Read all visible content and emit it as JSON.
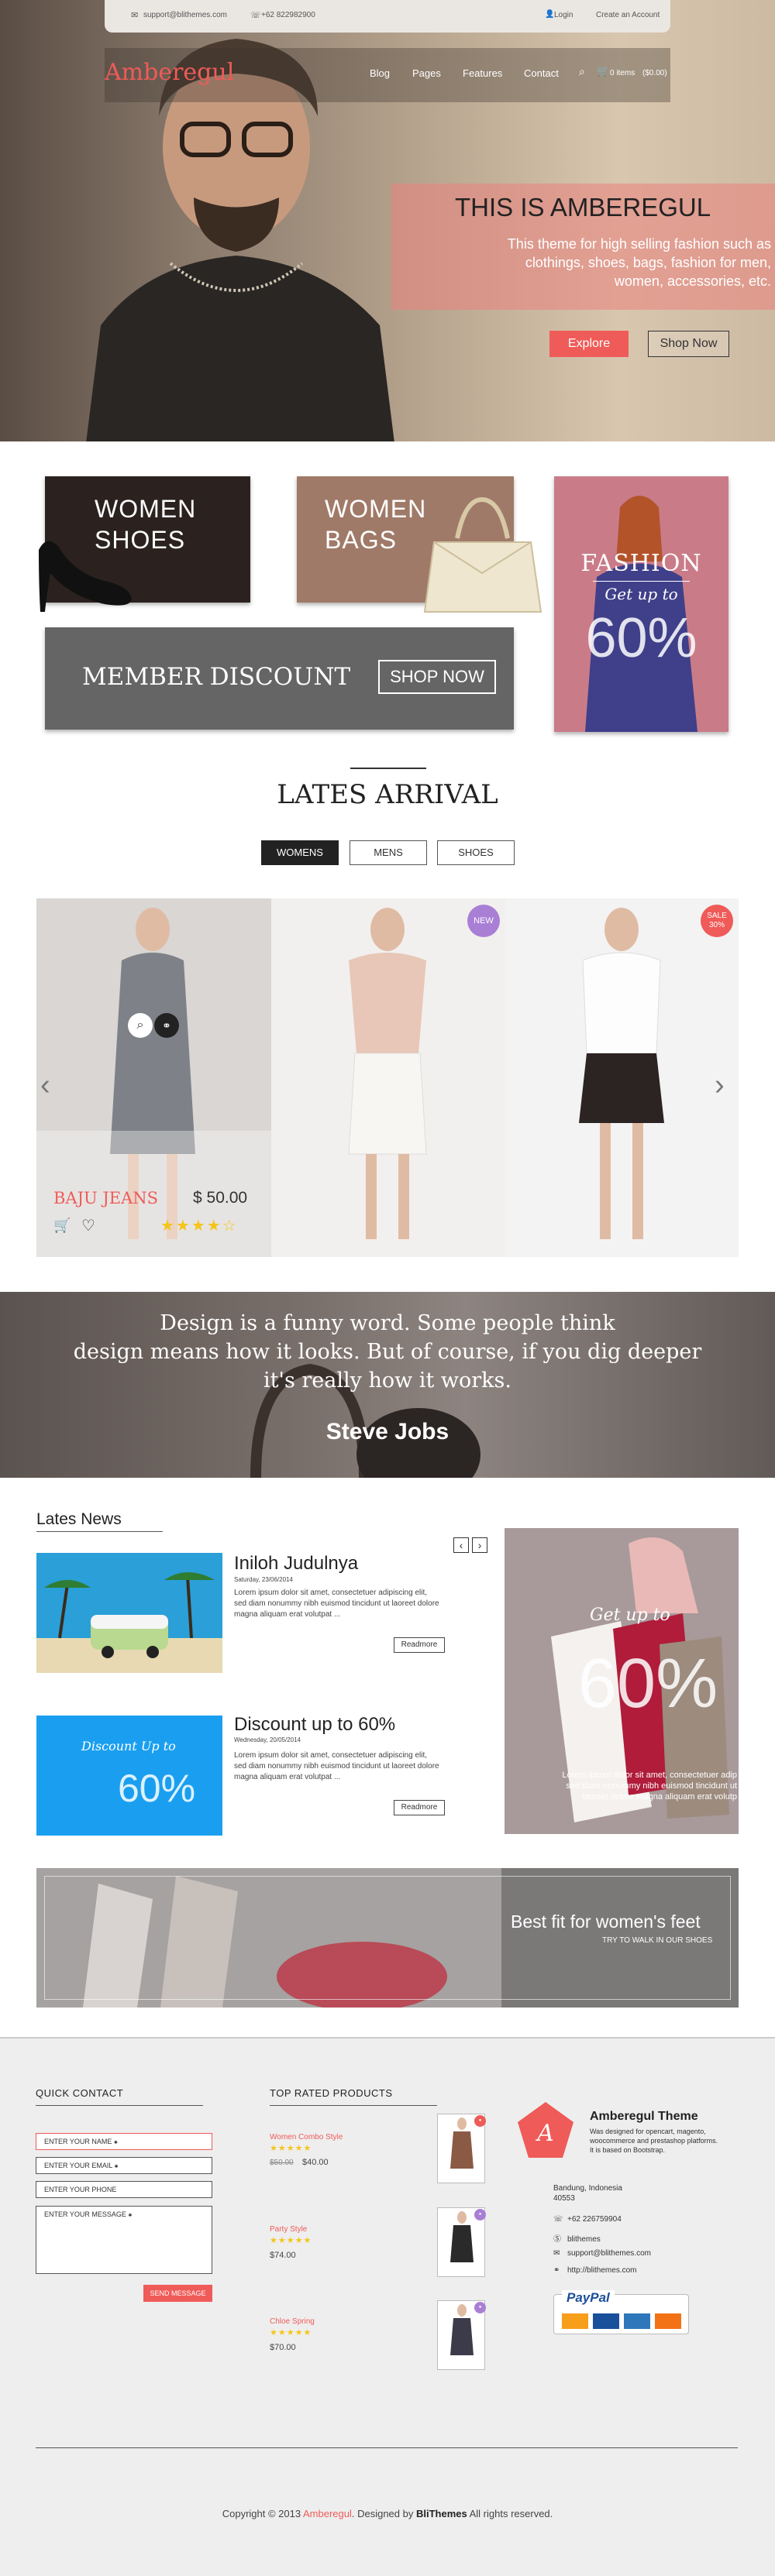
{
  "topbar": {
    "email": "support@blithemes.com",
    "phone": "+62 822982900",
    "login": "Login",
    "create_account": "Create an Account"
  },
  "brand": {
    "name": "Amberegul",
    "accent": "#ef5b58"
  },
  "nav": {
    "items": [
      "Blog",
      "Pages",
      "Features",
      "Contact"
    ],
    "cart": "0 items",
    "cart_total": "($0.00)"
  },
  "hero": {
    "title": "THIS IS AMBEREGUL",
    "text": [
      "This theme for high selling fashion such as",
      "clothings, shoes, bags, fashion for men,",
      "women, accessories, etc."
    ],
    "explore": "Explore",
    "shop_now": "Shop Now"
  },
  "promos": {
    "shoes": [
      "WOMEN",
      "SHOES"
    ],
    "bags": [
      "WOMEN",
      "BAGS"
    ],
    "fashion_title": "FASHION",
    "fashion_sub": "Get up to",
    "fashion_pct": "60%",
    "member": "MEMBER DISCOUNT",
    "member_btn": "SHOP NOW"
  },
  "arrivals": {
    "title": "LATES ARRIVAL",
    "tabs": [
      "WOMENS",
      "MENS",
      "SHOES"
    ],
    "product_name": "BAJU JEANS",
    "product_price": "$ 50.00",
    "rating": 4,
    "new_badge": "NEW",
    "sale_badge": "SALE",
    "sale_pct": "30%"
  },
  "quote": {
    "lines": [
      "Design is a funny word. Some people think",
      "design means how it looks. But of course, if you dig deeper",
      "it's really how it works."
    ],
    "author": "Steve Jobs"
  },
  "news": {
    "heading": "Lates News",
    "items": [
      {
        "title": "Iniloh Judulnya",
        "date": "Saturday, 23/06/2014",
        "text": [
          "Lorem ipsum dolor sit amet, consectetuer adipiscing elit,",
          "sed diam nonummy nibh euismod tincidunt ut laoreet dolore",
          "magna aliquam erat volutpat ..."
        ],
        "readmore": "Readmore"
      },
      {
        "title": "Discount up to 60%",
        "date": "Wednesday, 20/05/2014",
        "text": [
          "Lorem ipsum dolor sit amet, consectetuer adipiscing elit,",
          "sed diam nonummy nibh euismod tincidunt ut laoreet dolore",
          "magna aliquam erat volutpat ..."
        ],
        "readmore": "Readmore"
      }
    ],
    "discount_img_sub": "Discount Up to",
    "discount_img_pct": "60%"
  },
  "side_promo": {
    "sub": "Get up to",
    "pct": "60%",
    "text": [
      "Lorem ipsum dolor sit amet, consectetuer adip",
      "sed diam nonummy nibh euismod tincidunt ut",
      "laoreet dolore magna aliquam erat volutp"
    ]
  },
  "banner": {
    "title": "Best fit for women's feet",
    "sub": "TRY TO WALK IN OUR SHOES"
  },
  "footer": {
    "quick_contact": {
      "heading": "QUICK CONTACT",
      "name": "ENTER YOUR NAME",
      "email": "ENTER YOUR EMAIL",
      "phone": "ENTER YOUR PHONE",
      "message": "ENTER YOUR MESSAGE",
      "send": "SEND MESSAGE"
    },
    "top_rated": {
      "heading": "TOP RATED PRODUCTS",
      "items": [
        {
          "name": "Women Combo Style",
          "old": "$50.00",
          "price": "$40.00"
        },
        {
          "name": "Party Style",
          "price": "$74.00"
        },
        {
          "name": "Chloe Spring",
          "price": "$70.00"
        }
      ]
    },
    "about": {
      "title": "Amberegul Theme",
      "desc": [
        "Was designed for opencart, magento,",
        "woocommerce and prestashop platforms.",
        "It is based on Bootstrap."
      ],
      "address": [
        "Bandung, Indonesia",
        "40553"
      ],
      "phone": "+62 226759904",
      "skype": "blithemes",
      "email": "support@blithemes.com",
      "web": "http://blithemes.com",
      "paypal": "PayPal"
    },
    "copyright_pre": "Copyright © 2013 ",
    "copyright_brand": "Amberegul",
    "copyright_mid": ". Designed by ",
    "copyright_by": "BliThemes",
    "copyright_post": " All rights reserved."
  }
}
